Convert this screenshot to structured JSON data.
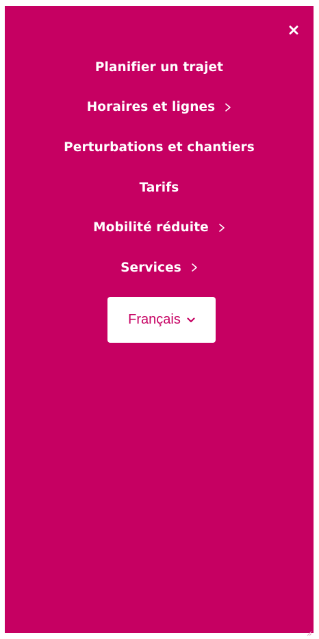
{
  "menu": {
    "background_color": "#c60062",
    "close_icon": "close-icon",
    "items": [
      {
        "label": "Planifier un trajet",
        "has_submenu": false
      },
      {
        "label": "Horaires et lignes",
        "has_submenu": true
      },
      {
        "label": "Perturbations et chantiers",
        "has_submenu": false
      },
      {
        "label": "Tarifs",
        "has_submenu": false
      },
      {
        "label": "Mobilité réduite",
        "has_submenu": true
      },
      {
        "label": "Services",
        "has_submenu": true
      }
    ]
  },
  "language": {
    "selected": "Français",
    "icon": "chevron-down-icon"
  }
}
